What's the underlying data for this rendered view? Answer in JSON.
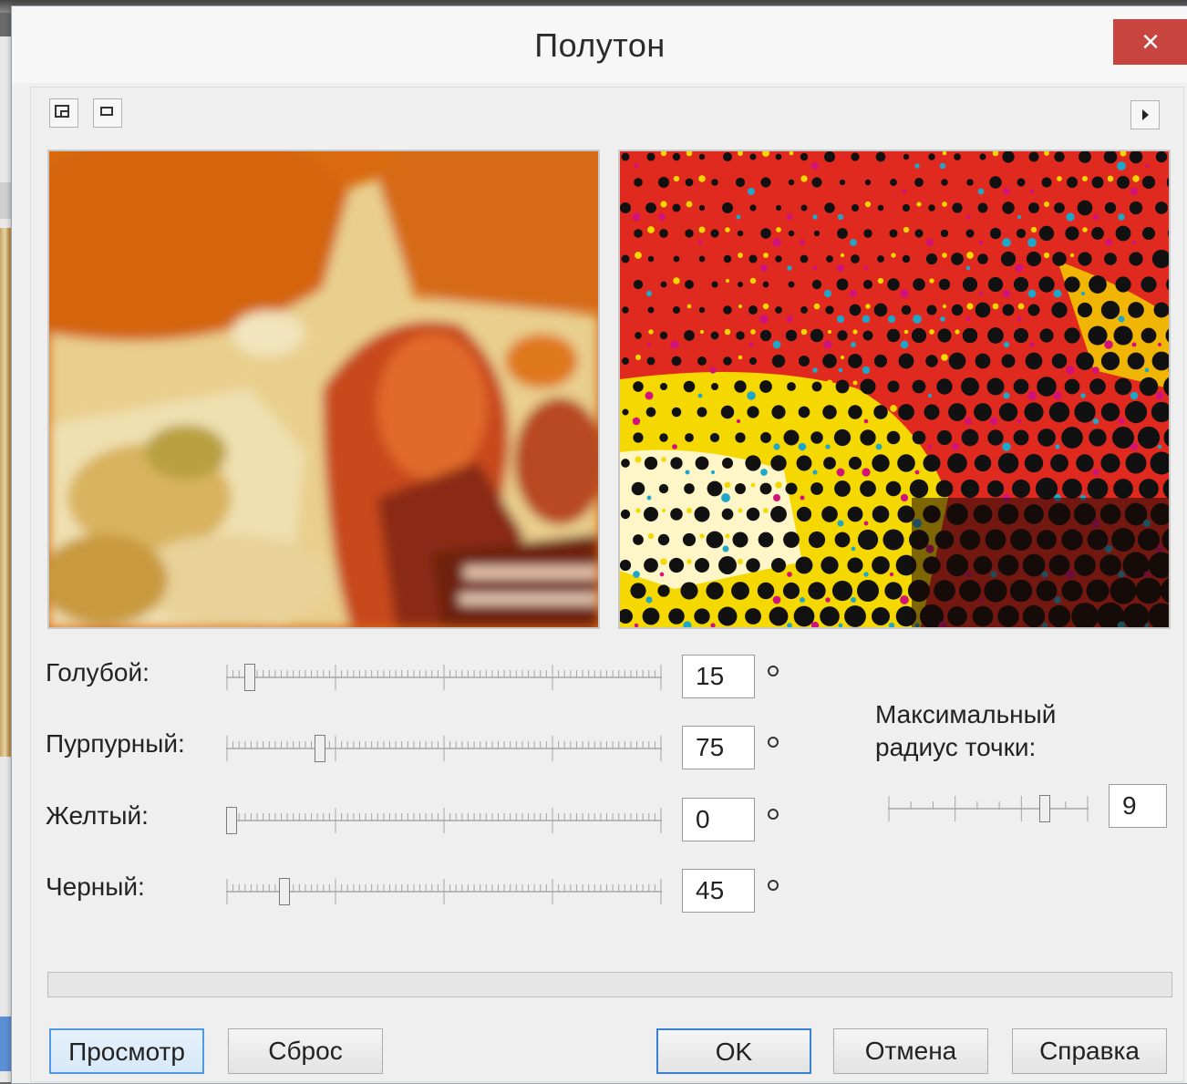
{
  "dialog": {
    "title": "Полутон",
    "close_label": "×"
  },
  "toolbar": {
    "left_buttons": [
      "dual-preview-icon",
      "single-preview-icon"
    ],
    "right_button": "play-icon"
  },
  "channels": [
    {
      "label": "Голубой:",
      "value": "15",
      "unit": "°",
      "level": 0.042
    },
    {
      "label": "Пурпурный:",
      "value": "75",
      "unit": "°",
      "level": 0.208
    },
    {
      "label": "Желтый:",
      "value": "0",
      "unit": "°",
      "level": 0.0
    },
    {
      "label": "Черный:",
      "value": "45",
      "unit": "°",
      "level": 0.125
    }
  ],
  "radius": {
    "label_line1": "Максимальный",
    "label_line2": "радиус точки:",
    "value": "9",
    "level": 0.8
  },
  "buttons": {
    "preview": "Просмотр",
    "reset": "Сброс",
    "ok": "OK",
    "cancel": "Отмена",
    "help": "Справка"
  },
  "colors": {
    "close_bg": "#c7453e",
    "preview_button_border": "#4f9ae0",
    "halftone_red": "#e02a1f",
    "halftone_yellow": "#f5d800",
    "halftone_black": "#111111",
    "halftone_cyan": "#1fa7c9"
  }
}
